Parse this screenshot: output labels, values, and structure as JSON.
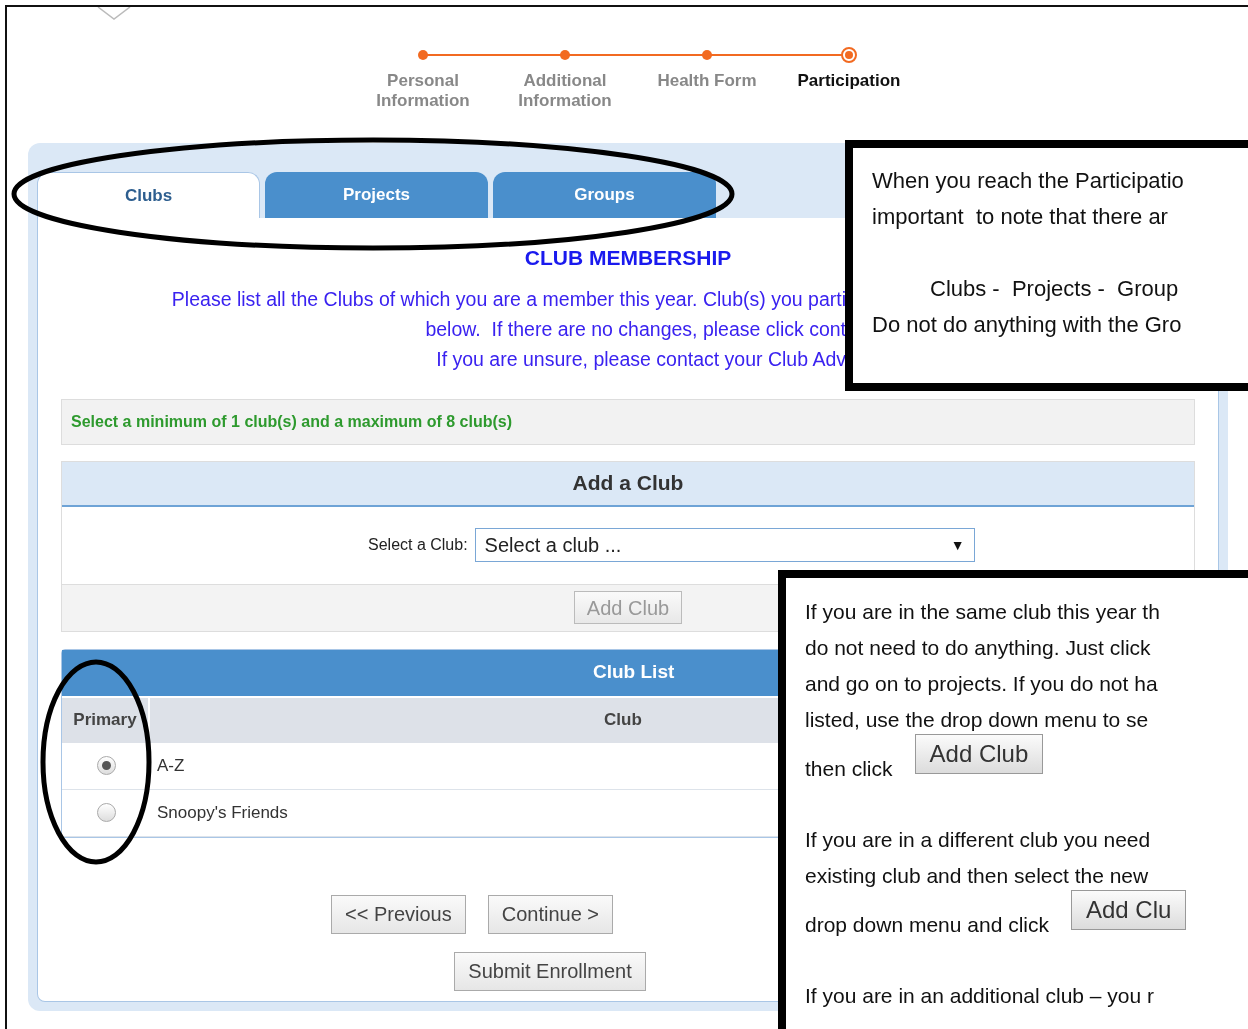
{
  "progress_steps": [
    {
      "label": "Personal Information",
      "selected": false
    },
    {
      "label": "Additional Information",
      "selected": false
    },
    {
      "label": "Health Form",
      "selected": false
    },
    {
      "label": "Participation",
      "selected": true
    }
  ],
  "tabs": [
    {
      "label": "Clubs",
      "selected": true
    },
    {
      "label": "Projects",
      "selected": false
    },
    {
      "label": "Groups",
      "selected": false
    }
  ],
  "section_title": "CLUB MEMBERSHIP",
  "instructions": [
    "Please list all the Clubs of which you are a member this year. Club(s) you parti",
    "below.  If there are no changes, please click cont",
    "If you are unsure, please contact your Club Adv"
  ],
  "selection_note": "Select a minimum of 1 club(s) and a maximum of 8 club(s)",
  "add_club_panel": {
    "title": "Add a Club",
    "select_label": "Select a Club:",
    "select_value": "Select a club ...",
    "dropdown_arrow": "▼",
    "button": "Add Club"
  },
  "club_list": {
    "title": "Club List",
    "columns": [
      "Primary",
      "Club"
    ],
    "rows": [
      {
        "club": "A-Z",
        "selected": true
      },
      {
        "club": "Snoopy's Friends",
        "selected": false
      }
    ]
  },
  "buttons": [
    "<< Previous",
    "Continue >",
    "Submit Enrollment"
  ],
  "callouts": [
    {
      "lines": [
        {
          "kind": "text",
          "text": "When you reach the Participatio"
        },
        {
          "kind": "text",
          "text": "important  to note that there ar"
        },
        {
          "kind": "gap"
        },
        {
          "kind": "indented",
          "text": "Clubs -  Projects -  Group"
        },
        {
          "kind": "text",
          "text": "Do not do anything with the Gro"
        }
      ]
    },
    {
      "lines": [
        {
          "kind": "text",
          "text": "If you are in the same club this year th"
        },
        {
          "kind": "text",
          "text": "do not need to do anything. Just click"
        },
        {
          "kind": "text",
          "text": "and go on to projects. If you do not ha"
        },
        {
          "kind": "text",
          "text": "listed, use the drop down menu to se"
        },
        {
          "kind": "button",
          "text": "then click",
          "button": "Add Club"
        },
        {
          "kind": "gap"
        },
        {
          "kind": "text",
          "text": "If you are in a different club you need"
        },
        {
          "kind": "text",
          "text": "existing club and then select the new"
        },
        {
          "kind": "button",
          "text": "drop down menu and click",
          "button": "Add Clu"
        },
        {
          "kind": "gap"
        },
        {
          "kind": "text",
          "text": "If you are in an additional club – you r"
        }
      ]
    }
  ]
}
